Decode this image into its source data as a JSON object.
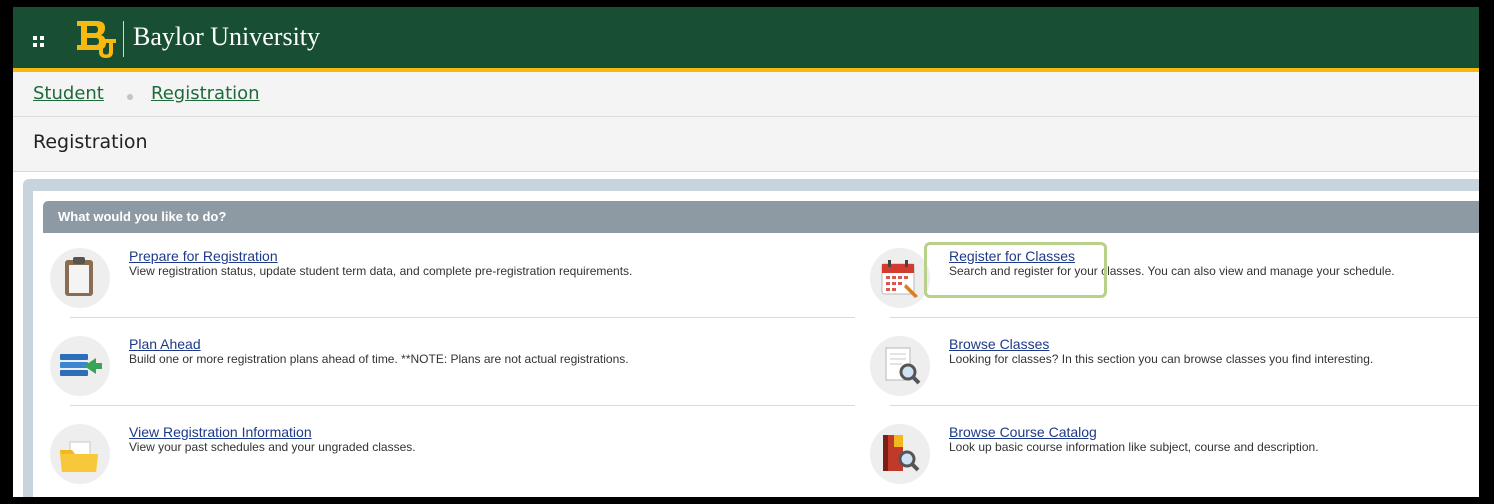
{
  "header": {
    "university_name": "Baylor University",
    "colors": {
      "green": "#184f32",
      "gold": "#f7b80f"
    }
  },
  "breadcrumb": {
    "items": [
      "Student",
      "Registration"
    ]
  },
  "page": {
    "title": "Registration"
  },
  "panel": {
    "heading": "What would you like to do?",
    "items": [
      {
        "label": "Prepare for Registration",
        "description": "View registration status, update student term data, and complete pre-registration requirements.",
        "icon": "clipboard-icon"
      },
      {
        "label": "Register for Classes",
        "description": "Search and register for your classes. You can also view and manage your schedule.",
        "icon": "calendar-icon"
      },
      {
        "label": "Plan Ahead",
        "description": "Build one or more registration plans ahead of time. **NOTE: Plans are not actual registrations.",
        "icon": "plan-list-icon"
      },
      {
        "label": "Browse Classes",
        "description": "Looking for classes? In this section you can browse classes you find interesting.",
        "icon": "document-search-icon"
      },
      {
        "label": "View Registration Information",
        "description": "View your past schedules and your ungraded classes.",
        "icon": "folder-icon"
      },
      {
        "label": "Browse Course Catalog",
        "description": "Look up basic course information like subject, course and description.",
        "icon": "book-search-icon"
      }
    ]
  }
}
